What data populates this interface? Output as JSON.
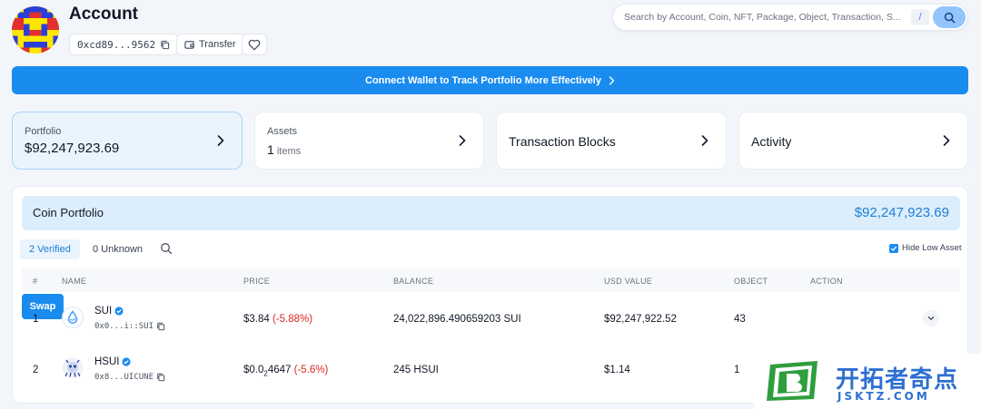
{
  "header": {
    "title": "Account",
    "address": "0xcd89...9562",
    "transfer_label": "Transfer"
  },
  "search": {
    "placeholder": "Search by Account, Coin, NFT, Package, Object, Transaction, S...",
    "shortcut": "/"
  },
  "banner": {
    "text": "Connect Wallet to Track Portfolio More Effectively"
  },
  "cards": {
    "portfolio": {
      "label": "Portfolio",
      "value": "$92,247,923.69"
    },
    "assets": {
      "label": "Assets",
      "count": "1",
      "unit": "items"
    },
    "transaction_blocks": {
      "label": "Transaction Blocks"
    },
    "activity": {
      "label": "Activity"
    }
  },
  "coin_portfolio": {
    "title": "Coin Portfolio",
    "total": "$92,247,923.69",
    "tabs": {
      "verified": "2 Verified",
      "unknown": "0 Unknown"
    },
    "hide_low_label": "Hide Low Asset",
    "columns": [
      "#",
      "NAME",
      "PRICE",
      "BALANCE",
      "USD VALUE",
      "OBJECT",
      "ACTION"
    ],
    "rows": [
      {
        "index": "1",
        "name": "SUI",
        "type": "0x0...i::SUI",
        "price": "$3.84",
        "change": "(-5.88%)",
        "balance": "24,022,896.490659203 SUI",
        "usd_value": "$92,247,922.52",
        "objects": "43",
        "action": "Swap"
      },
      {
        "index": "2",
        "name": "HSUI",
        "type": "0x8...UICUNE",
        "price_prefix": "$0.0",
        "price_zeros": "2",
        "price_digits": "4647",
        "change": "(-5.6%)",
        "balance": "245 HSUI",
        "usd_value": "$1.14",
        "objects": "1"
      }
    ]
  },
  "watermark": {
    "cn": "开拓者奇点",
    "en": "JSKTZ.COM"
  },
  "colors": {
    "accent": "#1a8cf0",
    "negative": "#dc2626",
    "page_bg": "#f2f6fb"
  }
}
